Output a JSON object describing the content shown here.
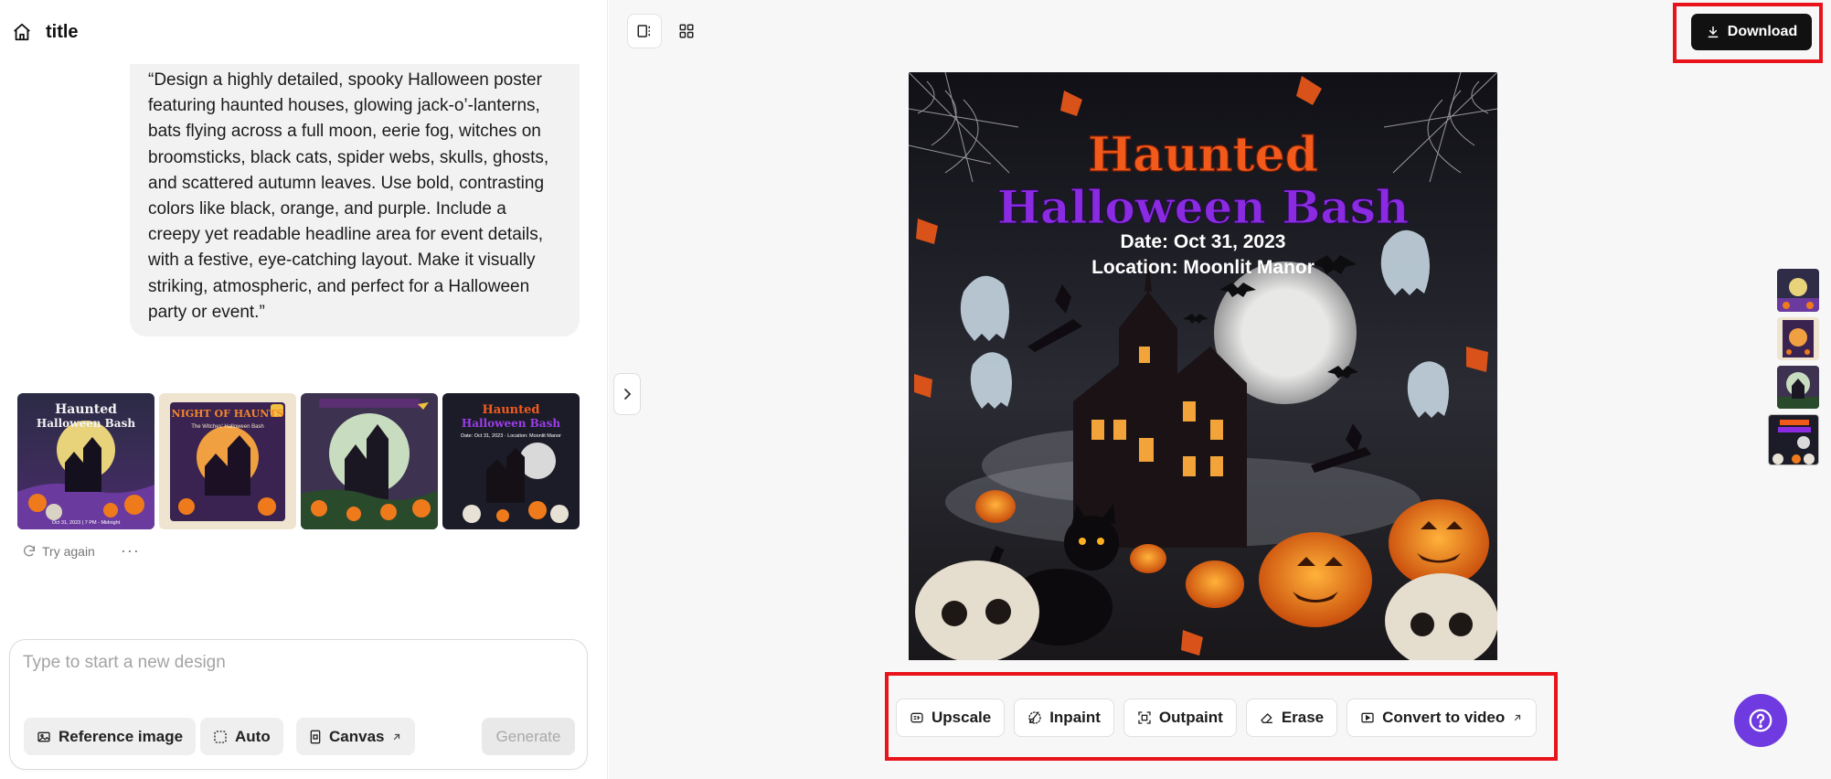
{
  "header": {
    "title": "title",
    "home_icon": "home-icon"
  },
  "prompt": {
    "text": "“Design a highly detailed, spooky Halloween poster featuring haunted houses, glowing jack-o’-lanterns, bats flying across a full moon, eerie fog, witches on broomsticks, black cats, spider webs, skulls, ghosts, and scattered autumn leaves. Use bold, contrasting colors like black, orange, and purple. Include a creepy yet readable headline area for event details, with a festive, eye-catching layout. Make it visually striking, atmospheric, and perfect for a Halloween party or event.”"
  },
  "results": {
    "thumbnails": [
      {
        "title_line1": "Haunted",
        "title_line2": "Halloween Bash",
        "footer": "Oct 31, 2023 | 7 PM - Midnight"
      },
      {
        "title_line1": "NIGHT OF HAUNTS",
        "title_line2": "The Witches' Halloween Bash",
        "footer": ""
      },
      {
        "title_line1": "",
        "title_line2": "",
        "footer": ""
      },
      {
        "title_line1": "Haunted",
        "title_line2": "Halloween Bash",
        "footer": "Date: Oct 31, 2023 · Location: Moonlit Manor"
      }
    ],
    "try_again_label": "Try again",
    "more_label": "···"
  },
  "composer": {
    "placeholder": "Type to start a new design",
    "value": "",
    "reference_label": "Reference image",
    "auto_label": "Auto",
    "canvas_label": "Canvas",
    "generate_label": "Generate"
  },
  "toolbar": {
    "download_label": "Download"
  },
  "poster": {
    "title_line1": "Haunted",
    "title_line2a": "Hallowee",
    "title_line2b": "n Bash",
    "date": "Date: Oct 31, 2023",
    "location": "Location: Moonlit Manor"
  },
  "actions": {
    "upscale": "Upscale",
    "inpaint": "Inpaint",
    "outpaint": "Outpaint",
    "erase": "Erase",
    "convert": "Convert to video"
  },
  "colors": {
    "accent_purple": "#6f3be0",
    "highlight_red": "#e8131b",
    "poster_orange": "#f25a1c",
    "poster_purple": "#8a2be2"
  }
}
